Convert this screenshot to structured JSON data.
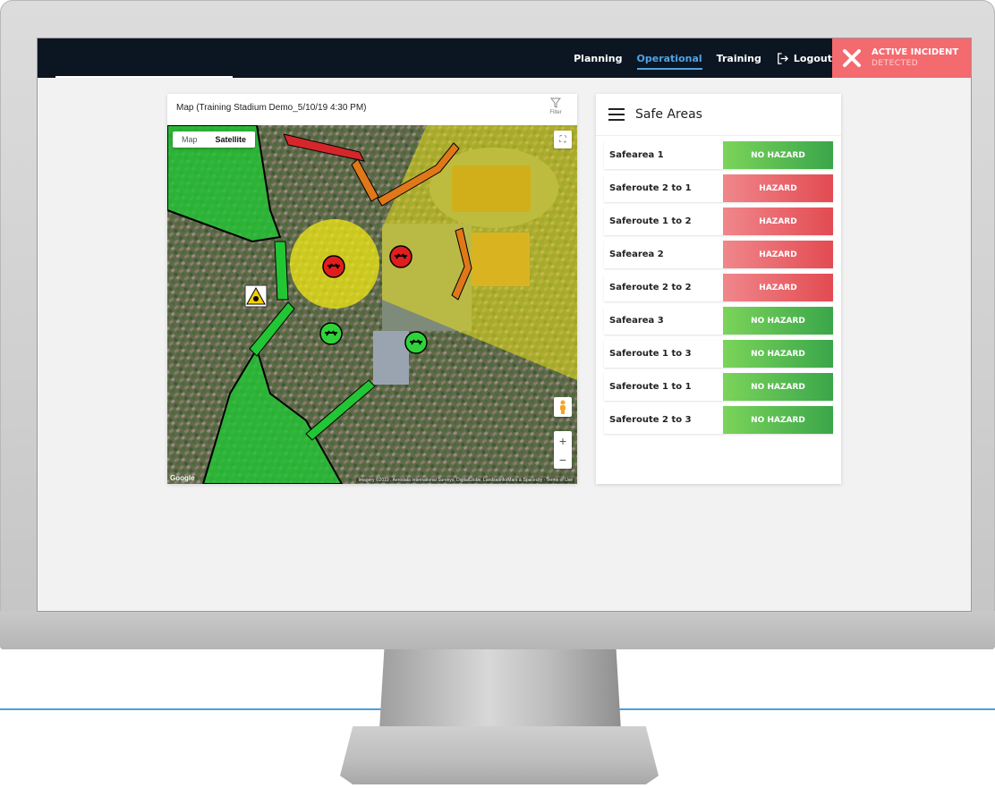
{
  "nav": {
    "items": [
      {
        "label": "Planning",
        "active": false
      },
      {
        "label": "Operational",
        "active": true
      },
      {
        "label": "Training",
        "active": false
      }
    ],
    "logout_label": "Logout",
    "logout_icon": "logout-icon"
  },
  "incident": {
    "title": "ACTIVE INCIDENT",
    "subtitle": "DETECTED",
    "icon": "close-x-icon",
    "color": "#f36a6f"
  },
  "map": {
    "title": "Map (Training Stadium Demo_5/10/19 4:30 PM)",
    "filter_label": "Filter",
    "type_map": "Map",
    "type_satellite": "Satellite",
    "selected_type": "Satellite",
    "google_label": "Google",
    "attribution": "Imagery ©2019 , Aerodata International Surveys, DigitalGlobe, Landsatinfo/Mars & Spacecity · Terms of Use",
    "zoom_in": "+",
    "zoom_out": "−"
  },
  "safe_areas": {
    "title": "Safe Areas",
    "rows": [
      {
        "name": "Safearea 1",
        "status": "NO HAZARD",
        "hazard": false
      },
      {
        "name": "Saferoute 2 to 1",
        "status": "HAZARD",
        "hazard": true
      },
      {
        "name": "Saferoute 1 to 2",
        "status": "HAZARD",
        "hazard": true
      },
      {
        "name": "Safearea 2",
        "status": "HAZARD",
        "hazard": true
      },
      {
        "name": "Saferoute 2 to 2",
        "status": "HAZARD",
        "hazard": true
      },
      {
        "name": "Safearea 3",
        "status": "NO HAZARD",
        "hazard": false
      },
      {
        "name": "Saferoute 1 to 3",
        "status": "NO HAZARD",
        "hazard": false
      },
      {
        "name": "Saferoute 1 to 1",
        "status": "NO HAZARD",
        "hazard": false
      },
      {
        "name": "Saferoute 2 to 3",
        "status": "NO HAZARD",
        "hazard": false
      }
    ]
  },
  "colors": {
    "topbar": "#0c1622",
    "nav_active": "#4fa3e3",
    "hazard": "#e24b52",
    "no_hazard": "#3aa64a"
  }
}
